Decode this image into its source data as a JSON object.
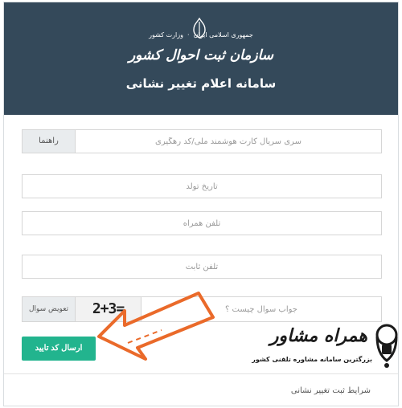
{
  "header": {
    "emblem_text": "جمهوری اسلامی ایران",
    "org_small": "وزارت کشور",
    "org_name": "سازمان ثبت احوال کشور",
    "system_title": "سامانه اعلام تغییر نشانی"
  },
  "form": {
    "serial": {
      "placeholder": "سری سریال کارت هوشمند ملی/کد رهگیری",
      "guide_label": "راهنما"
    },
    "birth_date": {
      "placeholder": "تاریخ تولد"
    },
    "mobile": {
      "placeholder": "تلفن همراه"
    },
    "landline": {
      "placeholder": "تلفن ثابت"
    },
    "captcha": {
      "placeholder": "جواب سوال چیست ؟",
      "question": "2+3=",
      "change_label": "تعویض سوال"
    },
    "submit_label": "ارسال کد تایید",
    "conditions_link": "شرایط ثبت تغییر نشانی"
  },
  "watermark": {
    "name": "همراه مشاور",
    "tagline": "بزرگترین سامانه مشاوره تلفنی کشور"
  },
  "colors": {
    "header_bg": "#34495a",
    "accent_green": "#22b48e",
    "annotation_orange": "#ea6a2a"
  }
}
